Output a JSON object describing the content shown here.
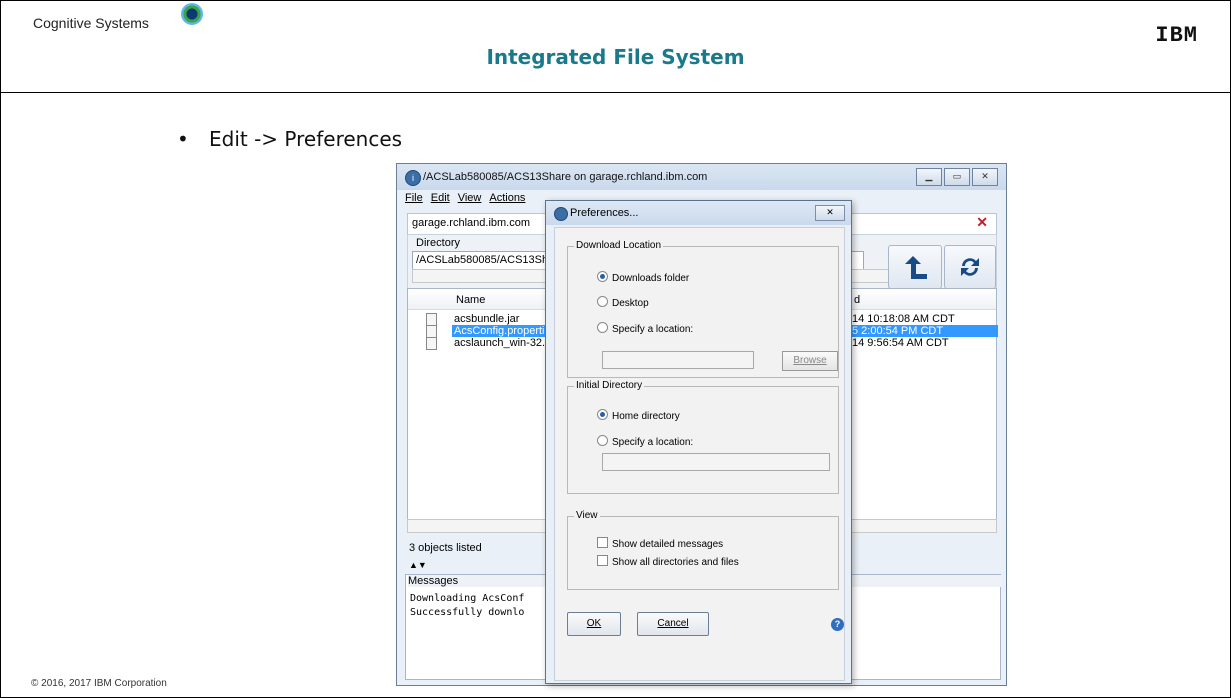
{
  "slide": {
    "brand": "Cognitive Systems",
    "title": "Integrated File System",
    "ibm_logo": "IBM",
    "bullet": "Edit -> Preferences",
    "copyright": "© 2016, 2017 IBM Corporation"
  },
  "window": {
    "title": "/ACSLab580085/ACS13Share on garage.rchland.ibm.com",
    "menu": [
      "File",
      "Edit",
      "View",
      "Actions"
    ],
    "host": "garage.rchland.ibm.com",
    "directory_label": "Directory",
    "directory_value": "/ACSLab580085/ACS13Share",
    "columns": {
      "name": "Name",
      "date": "d"
    },
    "files": [
      {
        "name": "acsbundle.jar",
        "date": "14 10:18:08 AM CDT",
        "selected": false
      },
      {
        "name": "AcsConfig.properties",
        "date": "5 2:00:54 PM CDT",
        "selected": true
      },
      {
        "name": "acslaunch_win-32.exe",
        "date": "14 9:56:54 AM CDT",
        "selected": false
      }
    ],
    "objects_listed": "3 objects listed",
    "messages_label": "Messages",
    "messages": [
      "Downloading AcsConf",
      "Successfully downlo"
    ]
  },
  "dialog": {
    "title": "Preferences...",
    "download_group": "Download Location",
    "download_options": [
      "Downloads folder",
      "Desktop",
      "Specify a location:"
    ],
    "download_selected": "Downloads folder",
    "browse": "Browse",
    "initial_group": "Initial Directory",
    "initial_options": [
      "Home directory",
      "Specify a location:"
    ],
    "initial_selected": "Home directory",
    "view_group": "View",
    "view_checks": [
      "Show detailed messages",
      "Show all directories and files"
    ],
    "ok": "OK",
    "cancel": "Cancel"
  },
  "colors": {
    "title": "#1a7a8c",
    "selection": "#3399ff",
    "close_x": "#c0202a"
  }
}
